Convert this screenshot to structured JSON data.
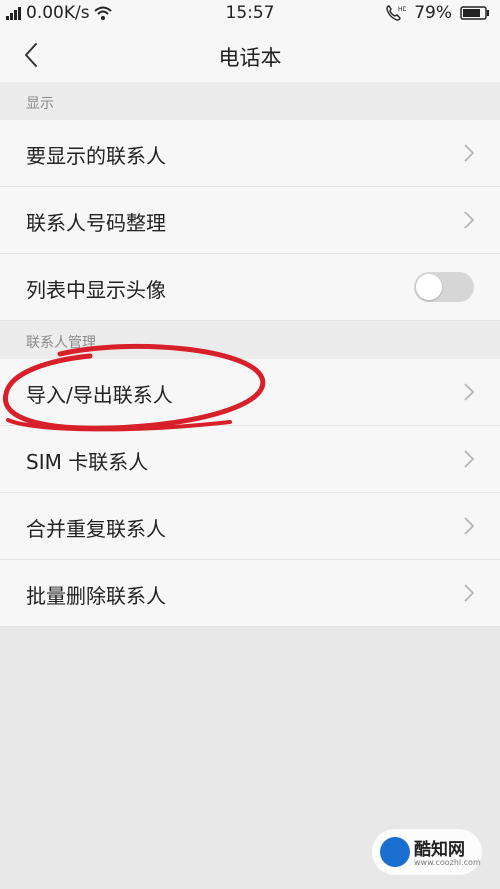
{
  "status_bar": {
    "network_speed": "0.00K/s",
    "time": "15:57",
    "call_badge": "HD",
    "battery": "79%"
  },
  "nav": {
    "title": "电话本",
    "back_icon": "chevron-left-icon"
  },
  "sections": [
    {
      "header": "显示",
      "items": [
        {
          "label": "要显示的联系人",
          "control": "chevron"
        },
        {
          "label": "联系人号码整理",
          "control": "chevron"
        },
        {
          "label": "列表中显示头像",
          "control": "toggle",
          "toggle_on": false
        }
      ]
    },
    {
      "header": "联系人管理",
      "items": [
        {
          "label": "导入/导出联系人",
          "control": "chevron"
        },
        {
          "label": "SIM 卡联系人",
          "control": "chevron"
        },
        {
          "label": "合并重复联系人",
          "control": "chevron"
        },
        {
          "label": "批量删除联系人",
          "control": "chevron"
        }
      ]
    }
  ],
  "annotation": {
    "color": "#d8202a",
    "target": "导入/导出联系人"
  },
  "watermark": {
    "text": "酷知网",
    "url": "www.coozhi.com"
  },
  "colors": {
    "background": "#e8e8e8",
    "row": "#f7f7f7",
    "toggle_off": "#d6d6d6"
  }
}
